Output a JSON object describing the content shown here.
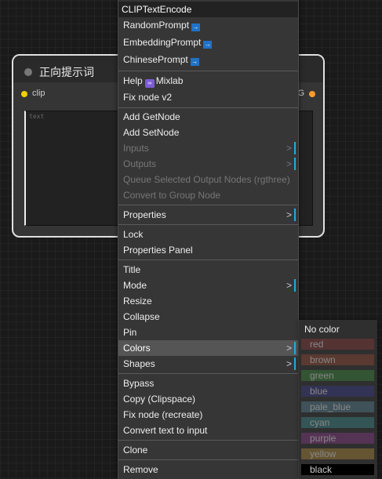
{
  "node": {
    "title": "正向提示词",
    "input_label": "clip",
    "output_label": "G",
    "textarea_placeholder": "text"
  },
  "menu": {
    "title": "CLIPTextEncode",
    "items": [
      {
        "label": "RandomPrompt"
      },
      {
        "label": "EmbeddingPrompt"
      },
      {
        "label": "ChinesePrompt"
      },
      {
        "label": "Help"
      },
      {
        "label": "Fix node v2"
      },
      {
        "label": "Add GetNode"
      },
      {
        "label": "Add SetNode"
      },
      {
        "label": "Inputs"
      },
      {
        "label": "Outputs"
      },
      {
        "label": "Queue Selected Output Nodes (rgthree)"
      },
      {
        "label": "Convert to Group Node"
      },
      {
        "label": "Properties"
      },
      {
        "label": "Lock"
      },
      {
        "label": "Properties Panel"
      },
      {
        "label": "Title"
      },
      {
        "label": "Mode"
      },
      {
        "label": "Resize"
      },
      {
        "label": "Collapse"
      },
      {
        "label": "Pin"
      },
      {
        "label": "Colors"
      },
      {
        "label": "Shapes"
      },
      {
        "label": "Bypass"
      },
      {
        "label": "Copy (Clipspace)"
      },
      {
        "label": "Fix node (recreate)"
      },
      {
        "label": "Convert text to input"
      },
      {
        "label": "Clone"
      },
      {
        "label": "Remove"
      }
    ],
    "help_badge": "Mixlab",
    "submenu_arrow": ">",
    "arrow_icon": "right-arrow-box-icon"
  },
  "colors_menu": {
    "heading": "No color",
    "options": [
      {
        "label": "red",
        "color": "#553333"
      },
      {
        "label": "brown",
        "color": "#593930"
      },
      {
        "label": "green",
        "color": "#335533"
      },
      {
        "label": "blue",
        "color": "#333355"
      },
      {
        "label": "pale_blue",
        "color": "#3f5159"
      },
      {
        "label": "cyan",
        "color": "#335555"
      },
      {
        "label": "purple",
        "color": "#553355"
      },
      {
        "label": "yellow",
        "color": "#665533"
      },
      {
        "label": "black",
        "color": "#000000"
      }
    ]
  },
  "accent": "#22aadd"
}
